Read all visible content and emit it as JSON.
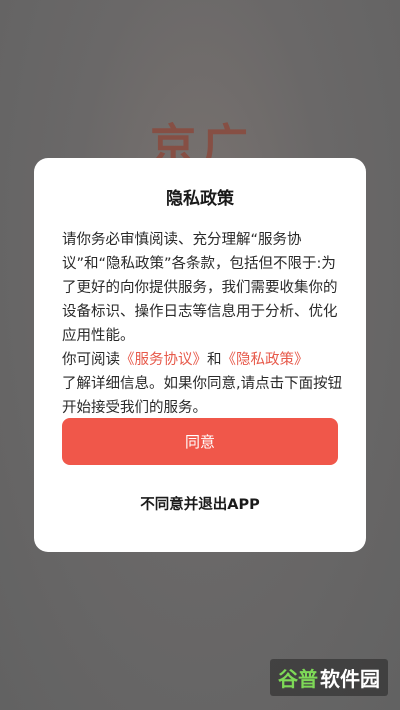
{
  "background": {
    "calligraphy_text": "京广"
  },
  "dialog": {
    "title": "隐私政策",
    "body_intro": "请你务必审慎阅读、充分理解“服务协议”和“隐私政策”各条款，包括但不限于:为了更好的向你提供服务，我们需要收集你的设备标识、操作日志等信息用于分析、优化应用性能。",
    "read_prefix": "你可阅读",
    "service_agreement_link": "《服务协议》",
    "and_text": "和",
    "privacy_policy_link": "《隐私政策》",
    "read_suffix": "了解详细信息。如果你同意,请点击下面按钮开始接受我们的服务。",
    "agree_button": "同意",
    "exit_button": "不同意并退出APP"
  },
  "watermark": {
    "part1": "谷普",
    "part2": "软件园"
  },
  "colors": {
    "accent": "#f0574a",
    "link": "#e75a4b",
    "overlay": "#6b6b6b"
  }
}
